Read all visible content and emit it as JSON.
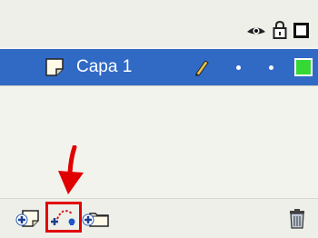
{
  "header": {
    "icons": [
      "eye-icon",
      "lock-icon",
      "outline-square-icon"
    ]
  },
  "layer": {
    "name": "Capa 1",
    "selected": true,
    "icons": [
      "layer-page-icon",
      "pencil-icon"
    ],
    "outline_color": "#35d835",
    "selection_color": "#316ac5"
  },
  "toolbar": {
    "buttons": [
      "add-layer-button",
      "add-motion-guide-button",
      "add-layer-folder-button",
      "delete-layer-button"
    ],
    "highlighted": "add-motion-guide-button",
    "highlight_color": "#e00000"
  }
}
